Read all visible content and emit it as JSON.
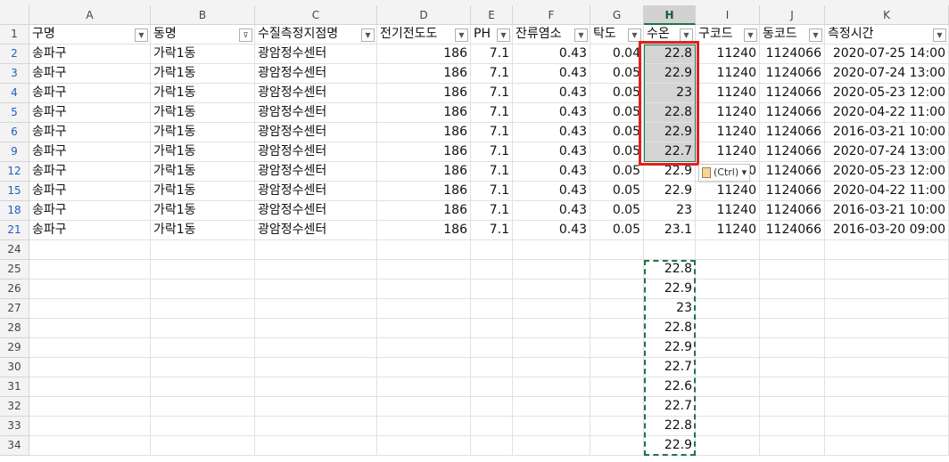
{
  "columns": [
    "A",
    "B",
    "C",
    "D",
    "E",
    "F",
    "G",
    "H",
    "I",
    "J",
    "K"
  ],
  "selected_column": "H",
  "colors": {
    "selection_border": "#e02020",
    "excel_green": "#217346",
    "selected_fill": "#d4d4d4"
  },
  "header_row": {
    "row_label": "1",
    "cells": [
      "구명",
      "동명",
      "수질측정지점명",
      "전기전도도",
      "PH",
      "잔류염소",
      "탁도",
      "수온",
      "구코드",
      "동코드",
      "측정시간"
    ],
    "filter_icons": [
      "dropdown-icon",
      "filter-active-icon",
      "dropdown-icon",
      "dropdown-icon",
      "dropdown-icon",
      "dropdown-icon",
      "dropdown-icon",
      "dropdown-icon",
      "dropdown-icon",
      "dropdown-icon",
      "dropdown-icon"
    ]
  },
  "data_rows": [
    {
      "row_label": "2",
      "cells": [
        "송파구",
        "가락1동",
        "광암정수센터",
        "186",
        "7.1",
        "0.43",
        "0.04",
        "22.8",
        "11240",
        "1124066",
        "2020-07-25 14:00"
      ]
    },
    {
      "row_label": "3",
      "cells": [
        "송파구",
        "가락1동",
        "광암정수센터",
        "186",
        "7.1",
        "0.43",
        "0.05",
        "22.9",
        "11240",
        "1124066",
        "2020-07-24 13:00"
      ]
    },
    {
      "row_label": "4",
      "cells": [
        "송파구",
        "가락1동",
        "광암정수센터",
        "186",
        "7.1",
        "0.43",
        "0.05",
        "23",
        "11240",
        "1124066",
        "2020-05-23 12:00"
      ]
    },
    {
      "row_label": "5",
      "cells": [
        "송파구",
        "가락1동",
        "광암정수센터",
        "186",
        "7.1",
        "0.43",
        "0.05",
        "22.8",
        "11240",
        "1124066",
        "2020-04-22 11:00"
      ]
    },
    {
      "row_label": "6",
      "cells": [
        "송파구",
        "가락1동",
        "광암정수센터",
        "186",
        "7.1",
        "0.43",
        "0.05",
        "22.9",
        "11240",
        "1124066",
        "2016-03-21 10:00"
      ]
    },
    {
      "row_label": "9",
      "cells": [
        "송파구",
        "가락1동",
        "광암정수센터",
        "186",
        "7.1",
        "0.43",
        "0.05",
        "22.7",
        "11240",
        "1124066",
        "2020-07-24 13:00"
      ]
    },
    {
      "row_label": "12",
      "cells": [
        "송파구",
        "가락1동",
        "광암정수센터",
        "186",
        "7.1",
        "0.43",
        "0.05",
        "22.9",
        "0",
        "1124066",
        "2020-05-23 12:00"
      ]
    },
    {
      "row_label": "15",
      "cells": [
        "송파구",
        "가락1동",
        "광암정수센터",
        "186",
        "7.1",
        "0.43",
        "0.05",
        "22.9",
        "11240",
        "1124066",
        "2020-04-22 11:00"
      ]
    },
    {
      "row_label": "18",
      "cells": [
        "송파구",
        "가락1동",
        "광암정수센터",
        "186",
        "7.1",
        "0.43",
        "0.05",
        "23",
        "11240",
        "1124066",
        "2016-03-21 10:00"
      ]
    },
    {
      "row_label": "21",
      "cells": [
        "송파구",
        "가락1동",
        "광암정수센터",
        "186",
        "7.1",
        "0.43",
        "0.05",
        "23.1",
        "11240",
        "1124066",
        "2016-03-20 09:00"
      ]
    }
  ],
  "empty_row_labels": [
    "24"
  ],
  "pasted_rows": [
    {
      "row_label": "25",
      "value": "22.8"
    },
    {
      "row_label": "26",
      "value": "22.9"
    },
    {
      "row_label": "27",
      "value": "23"
    },
    {
      "row_label": "28",
      "value": "22.8"
    },
    {
      "row_label": "29",
      "value": "22.9"
    },
    {
      "row_label": "30",
      "value": "22.7"
    },
    {
      "row_label": "31",
      "value": "22.6"
    },
    {
      "row_label": "32",
      "value": "22.7"
    },
    {
      "row_label": "33",
      "value": "22.8"
    },
    {
      "row_label": "34",
      "value": "22.9"
    }
  ],
  "paste_options": {
    "label": "(Ctrl)",
    "icon": "clipboard-icon",
    "arrow_icon": "chevron-down-icon"
  }
}
